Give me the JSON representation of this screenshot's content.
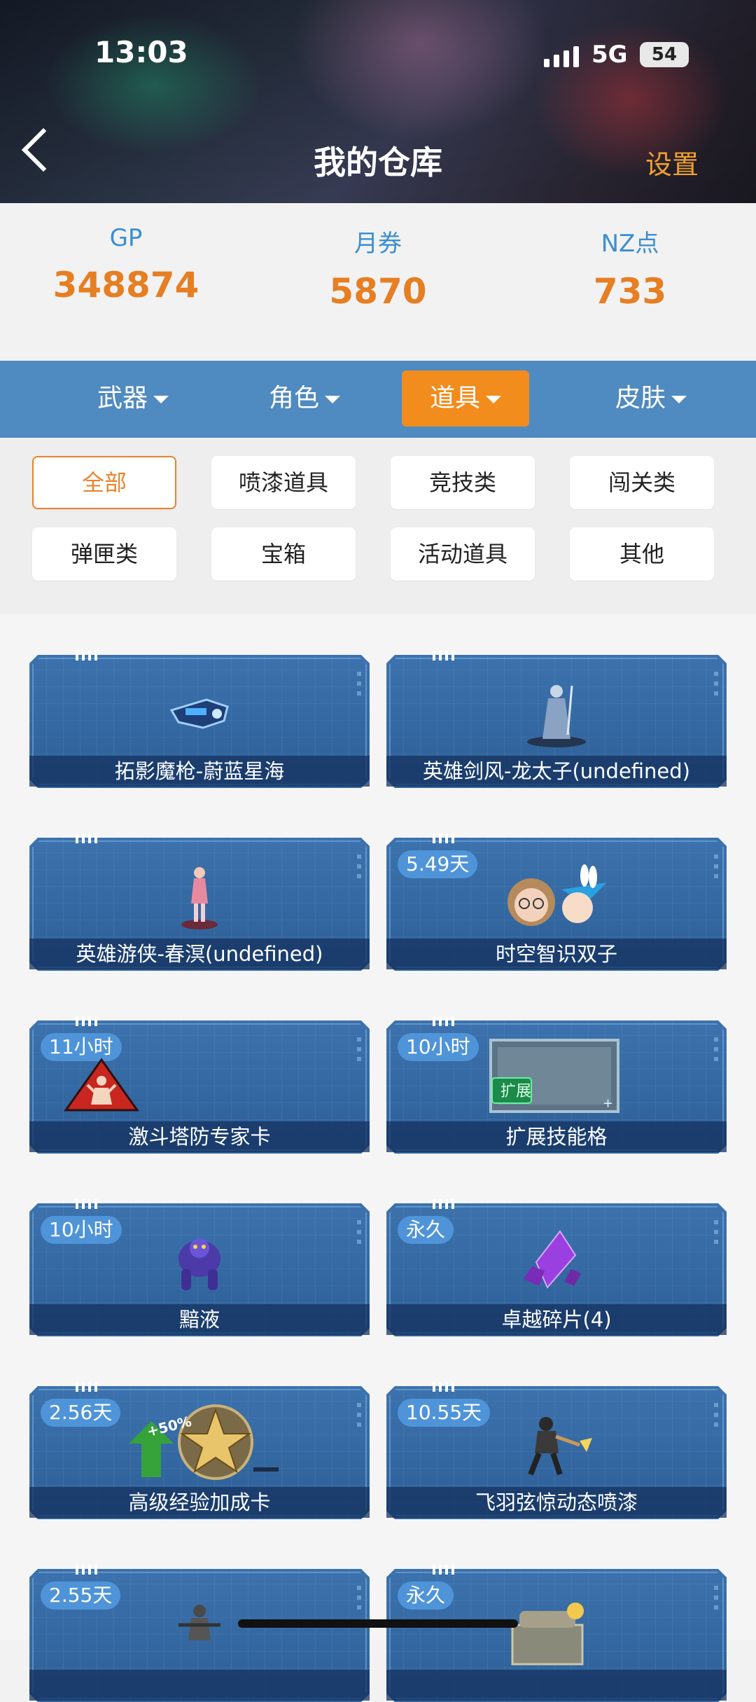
{
  "status_bar": {
    "time": "13:03",
    "network": "5G",
    "battery": "54"
  },
  "header": {
    "title": "我的仓库",
    "settings_label": "设置"
  },
  "currencies": [
    {
      "label": "GP",
      "value": "348874"
    },
    {
      "label": "月券",
      "value": "5870"
    },
    {
      "label": "NZ点",
      "value": "733"
    }
  ],
  "categories": [
    {
      "label": "武器",
      "active": false
    },
    {
      "label": "角色",
      "active": false
    },
    {
      "label": "道具",
      "active": true
    },
    {
      "label": "皮肤",
      "active": false
    }
  ],
  "filters": [
    {
      "label": "全部",
      "active": true
    },
    {
      "label": "喷漆道具"
    },
    {
      "label": "竞技类"
    },
    {
      "label": "闯关类"
    },
    {
      "label": "弹匣类"
    },
    {
      "label": "宝箱"
    },
    {
      "label": "活动道具"
    },
    {
      "label": "其他"
    }
  ],
  "items": [
    {
      "name": "拓影魔枪-蔚蓝星海",
      "badge": "",
      "icon": "gun-icon"
    },
    {
      "name": "英雄剑风-龙太子(undefined)",
      "badge": "",
      "icon": "swordsman-figure-icon"
    },
    {
      "name": "英雄游侠-春溟(undefined)",
      "badge": "",
      "icon": "ranger-figure-icon"
    },
    {
      "name": "时空智识双子",
      "badge": "5.49天",
      "icon": "twins-avatar-icon"
    },
    {
      "name": "激斗塔防专家卡",
      "badge": "11小时",
      "icon": "warning-card-icon"
    },
    {
      "name": "扩展技能格",
      "badge": "10小时",
      "icon": "expand-slot-icon"
    },
    {
      "name": "黯液",
      "badge": "10小时",
      "icon": "monster-icon"
    },
    {
      "name": "卓越碎片(4)",
      "badge": "永久",
      "icon": "crystal-shard-icon"
    },
    {
      "name": "高级经验加成卡",
      "badge": "2.56天",
      "icon": "star-medal-icon",
      "bonus": "+50%"
    },
    {
      "name": "飞羽弦惊动态喷漆",
      "badge": "10.55天",
      "icon": "spray-figure-icon"
    },
    {
      "name": "",
      "badge": "2.55天",
      "icon": "soldier-icon"
    },
    {
      "name": "",
      "badge": "永久",
      "icon": "chest-icon"
    }
  ]
}
